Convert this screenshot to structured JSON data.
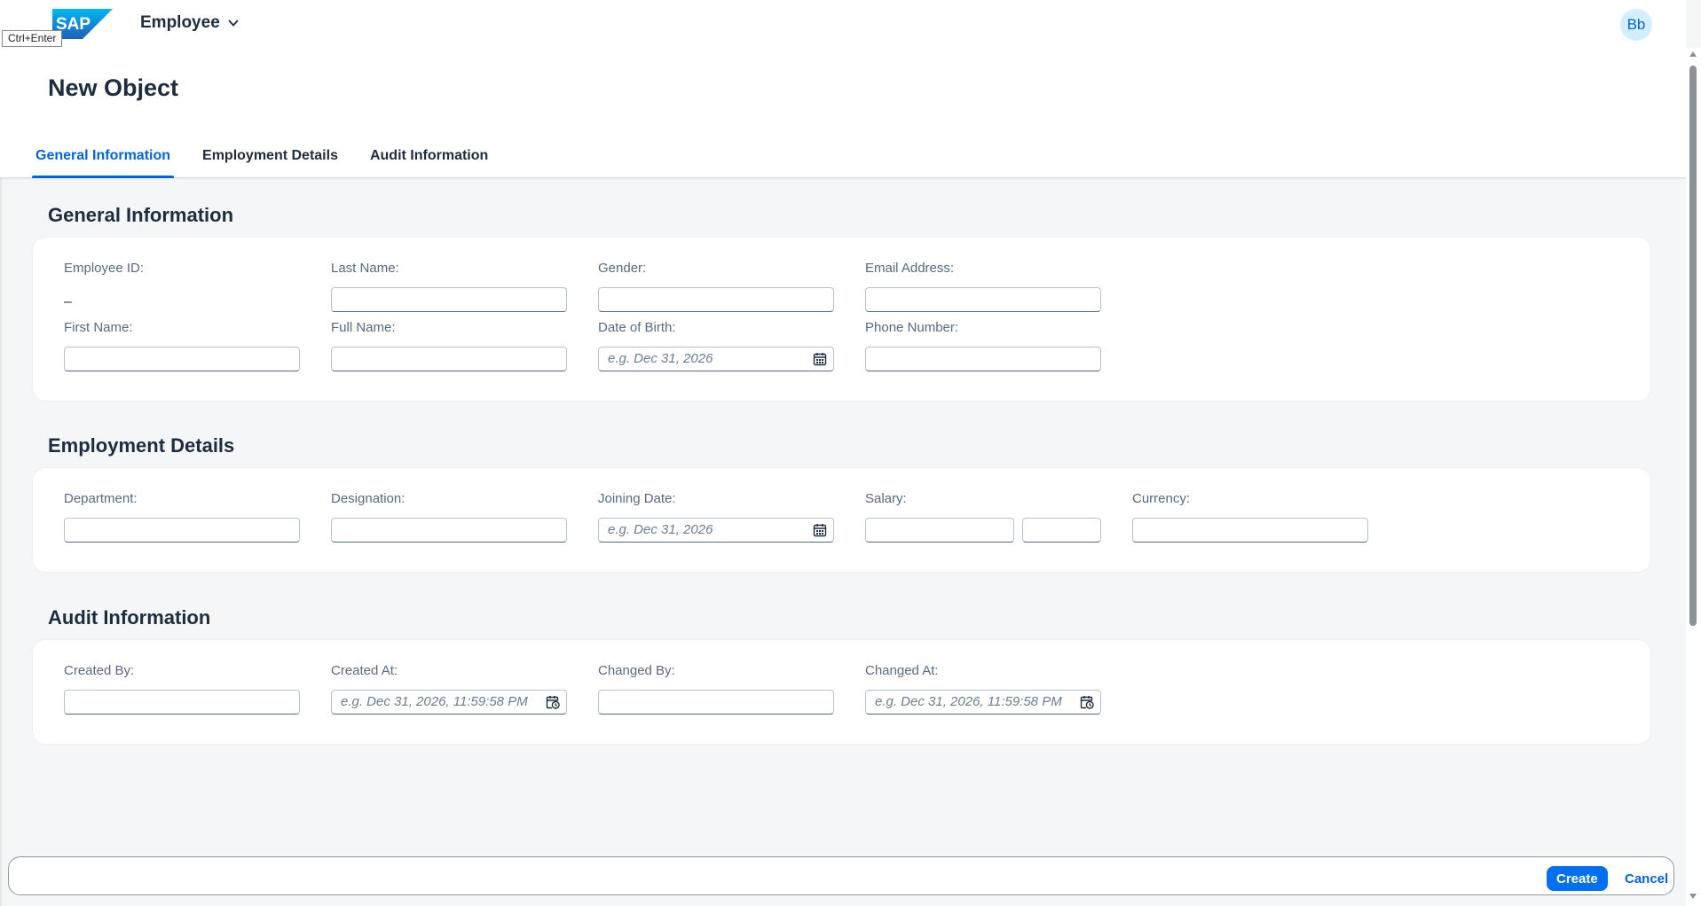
{
  "shell": {
    "logo_text": "SAP",
    "ctrl_hint": "Ctrl+Enter",
    "app_title": "Employee",
    "avatar_initials": "Bb"
  },
  "header": {
    "title": "New Object",
    "tabs": [
      {
        "label": "General Information",
        "active": true
      },
      {
        "label": "Employment Details",
        "active": false
      },
      {
        "label": "Audit Information",
        "active": false
      }
    ]
  },
  "sections": {
    "general": {
      "title": "General Information",
      "employee_id": {
        "label": "Employee ID:",
        "value": "–"
      },
      "last_name": {
        "label": "Last Name:",
        "value": ""
      },
      "gender": {
        "label": "Gender:",
        "value": ""
      },
      "email": {
        "label": "Email Address:",
        "value": ""
      },
      "first_name": {
        "label": "First Name:",
        "value": ""
      },
      "full_name": {
        "label": "Full Name:",
        "value": ""
      },
      "dob": {
        "label": "Date of Birth:",
        "placeholder": "e.g. Dec 31, 2026"
      },
      "phone": {
        "label": "Phone Number:",
        "value": ""
      }
    },
    "employment": {
      "title": "Employment Details",
      "department": {
        "label": "Department:",
        "value": ""
      },
      "designation": {
        "label": "Designation:",
        "value": ""
      },
      "joining_date": {
        "label": "Joining Date:",
        "placeholder": "e.g. Dec 31, 2026"
      },
      "salary": {
        "label": "Salary:",
        "value": "",
        "unit_value": ""
      },
      "currency": {
        "label": "Currency:",
        "value": ""
      }
    },
    "audit": {
      "title": "Audit Information",
      "created_by": {
        "label": "Created By:",
        "value": ""
      },
      "created_at": {
        "label": "Created At:",
        "placeholder": "e.g. Dec 31, 2026, 11:59:58 PM"
      },
      "changed_by": {
        "label": "Changed By:",
        "value": ""
      },
      "changed_at": {
        "label": "Changed At:",
        "placeholder": "e.g. Dec 31, 2026, 11:59:58 PM"
      }
    }
  },
  "footer": {
    "create_label": "Create",
    "cancel_label": "Cancel"
  },
  "icons": {
    "calendar": "calendar-icon",
    "datetime": "date-time-icon",
    "chevron": "chevron-down-icon"
  },
  "colors": {
    "accent": "#0064d9",
    "button": "#0070f2",
    "background": "#f5f6f7",
    "avatar_bg": "#d1efff"
  }
}
